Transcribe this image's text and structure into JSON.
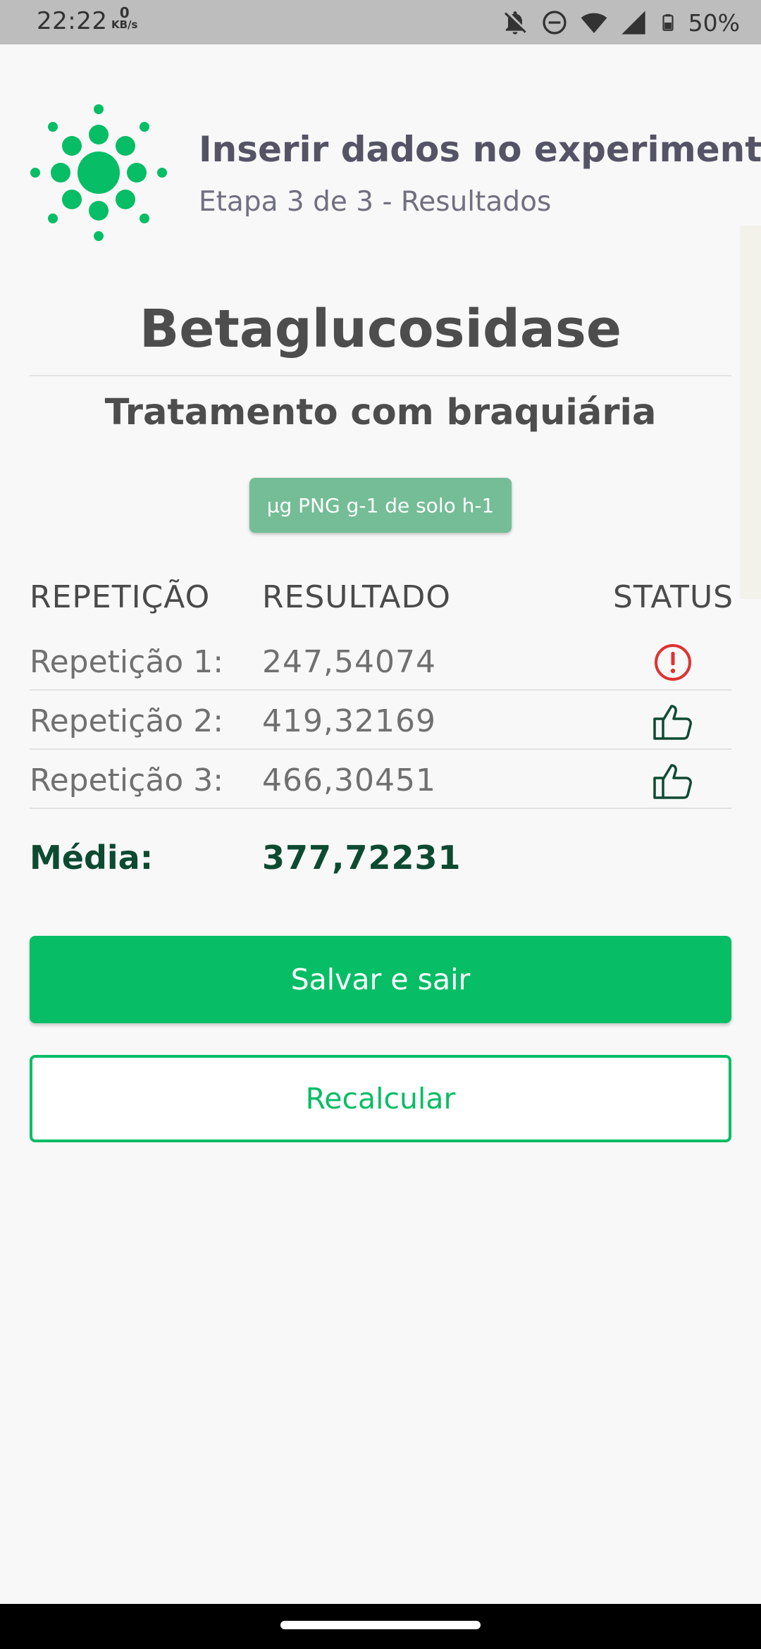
{
  "status_bar": {
    "time": "22:22",
    "net_speed": "0",
    "net_unit": "KB/s",
    "battery": "50%"
  },
  "header": {
    "title": "Inserir dados no experimento",
    "subtitle": "Etapa 3 de 3 - Resultados",
    "logo_icon": "sun-dots-logo-icon",
    "accent_color": "#07bd65"
  },
  "main": {
    "enzyme": "Betaglucosidase",
    "treatment": "Tratamento com braquiária",
    "unit": "µg PNG g-1 de solo h-1"
  },
  "table": {
    "headers": {
      "repetition": "REPETIÇÃO",
      "result": "RESULTADO",
      "status": "STATUS"
    },
    "rows": [
      {
        "label": "Repetição 1:",
        "value": "247,54074",
        "status": "alert-circle-icon"
      },
      {
        "label": "Repetição 2:",
        "value": "419,32169",
        "status": "thumbs-up-icon"
      },
      {
        "label": "Repetição 3:",
        "value": "466,30451",
        "status": "thumbs-up-icon"
      }
    ],
    "average_label": "Média:",
    "average_value": "377,72231"
  },
  "buttons": {
    "save": "Salvar e sair",
    "recalculate": "Recalcular"
  }
}
